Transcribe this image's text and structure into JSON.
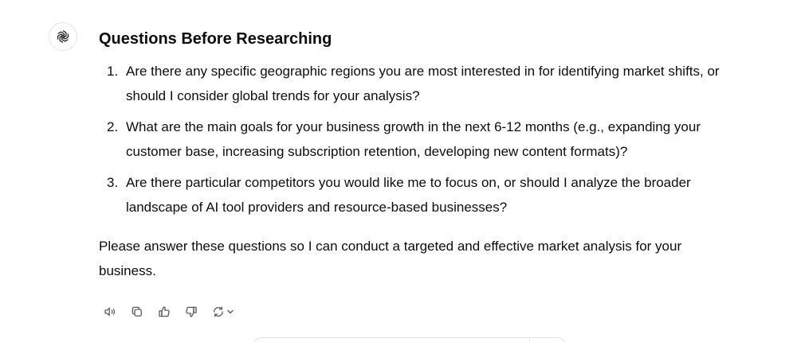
{
  "assistant": {
    "avatar_icon": "openai-logo-icon"
  },
  "message": {
    "heading": "Questions Before Researching",
    "questions": [
      {
        "number": "1.",
        "text": "Are there any specific geographic regions you are most interested in for identifying market shifts, or should I consider global trends for your analysis?"
      },
      {
        "number": "2.",
        "text": "What are the main goals for your business growth in the next 6-12 months (e.g., expanding your customer base, increasing subscription retention, developing new content formats)?"
      },
      {
        "number": "3.",
        "text": "Are there particular competitors you would like me to focus on, or should I analyze the broader landscape of AI tool providers and resource-based businesses?"
      }
    ],
    "closing": "Please answer these questions so I can conduct a targeted and effective market analysis for your business."
  },
  "actions": [
    {
      "name": "read-aloud-button",
      "icon": "speaker-icon"
    },
    {
      "name": "copy-button",
      "icon": "copy-icon"
    },
    {
      "name": "good-response-button",
      "icon": "thumbs-up-icon"
    },
    {
      "name": "bad-response-button",
      "icon": "thumbs-down-icon"
    },
    {
      "name": "regenerate-button",
      "icon": "refresh-icon"
    }
  ],
  "colors": {
    "text": "#0d0d0d",
    "icon": "#5d5d5d",
    "border": "#e3e3e3"
  }
}
